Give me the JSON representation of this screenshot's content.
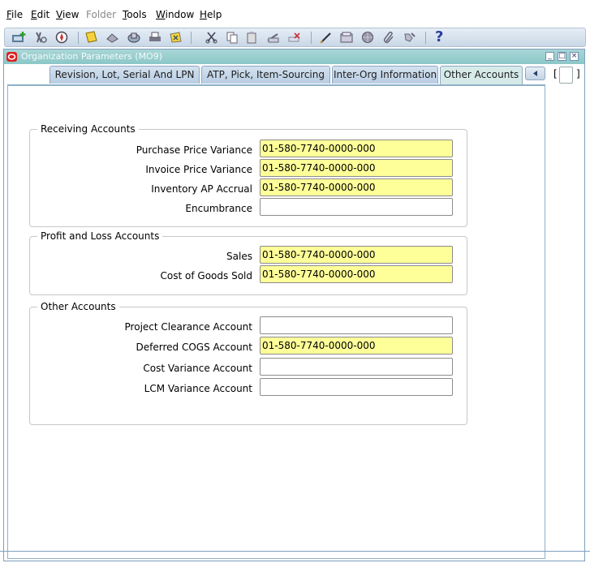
{
  "menu": {
    "items": [
      {
        "label": "File",
        "mnemonic": "F",
        "rest": "ile"
      },
      {
        "label": "Edit",
        "mnemonic": "E",
        "rest": "dit"
      },
      {
        "label": "View",
        "mnemonic": "V",
        "rest": "iew"
      },
      {
        "label": "Folder",
        "mnemonic": "",
        "rest": "Folder"
      },
      {
        "label": "Tools",
        "mnemonic": "T",
        "rest": "ools"
      },
      {
        "label": "Window",
        "mnemonic": "W",
        "rest": "indow"
      },
      {
        "label": "Help",
        "mnemonic": "H",
        "rest": "elp"
      }
    ]
  },
  "toolbar": {
    "icons": [
      "new-record-icon",
      "find-icon",
      "navigator-icon",
      "save-icon",
      "next-step-icon",
      "switch-responsibility-icon",
      "print-icon",
      "close-form-icon",
      "cut-icon",
      "copy-icon",
      "paste-icon",
      "clear-record-icon",
      "delete-record-icon",
      "edit-field-icon",
      "zoom-icon",
      "translations-icon",
      "attachments-icon",
      "folder-tools-icon",
      "help-icon"
    ],
    "help_glyph": "?"
  },
  "window": {
    "title": "Organization Parameters (MO9)",
    "controls": {
      "minimize": "_",
      "maximize": "□",
      "close": "×"
    }
  },
  "tabs": [
    {
      "label": "Revision, Lot, Serial And LPN",
      "active": false
    },
    {
      "label": "ATP, Pick, Item-Sourcing",
      "active": false
    },
    {
      "label": "Inter-Org Information",
      "active": false
    },
    {
      "label": "Other Accounts",
      "active": true
    }
  ],
  "groups": {
    "receiving": {
      "title": "Receiving Accounts",
      "fields": [
        {
          "label": "Purchase Price Variance",
          "value": "01-580-7740-0000-000",
          "required": true
        },
        {
          "label": "Invoice Price Variance",
          "value": "01-580-7740-0000-000",
          "required": true
        },
        {
          "label": "Inventory AP Accrual",
          "value": "01-580-7740-0000-000",
          "required": true
        },
        {
          "label": "Encumbrance",
          "value": "",
          "required": false
        }
      ]
    },
    "profit_loss": {
      "title": "Profit and Loss Accounts",
      "fields": [
        {
          "label": "Sales",
          "value": "01-580-7740-0000-000",
          "required": true
        },
        {
          "label": "Cost of Goods Sold",
          "value": "01-580-7740-0000-000",
          "required": true
        }
      ]
    },
    "other": {
      "title": "Other Accounts",
      "fields": [
        {
          "label": "Project Clearance Account",
          "value": "",
          "required": false
        },
        {
          "label": "Deferred COGS Account",
          "value": "01-580-7740-0000-000",
          "required": true
        },
        {
          "label": "Cost Variance Account",
          "value": "",
          "required": false
        },
        {
          "label": "LCM Variance Account",
          "value": "",
          "required": false
        }
      ]
    }
  },
  "side_indicator": {
    "open": "[",
    "close": "]"
  },
  "colors": {
    "required_field": "#ffff99",
    "title_bar": "#8cc7c8",
    "tab_active": "#d6ebe9"
  }
}
